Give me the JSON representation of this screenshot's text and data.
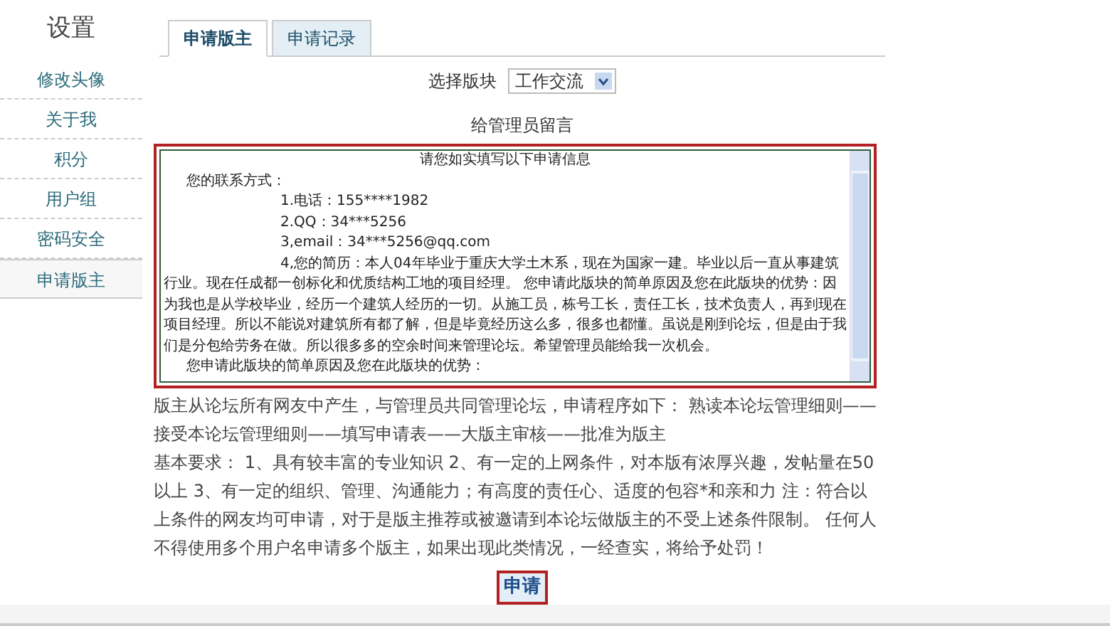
{
  "sidebar": {
    "title": "设置",
    "items": [
      {
        "label": "修改头像",
        "selected": false
      },
      {
        "label": "关于我",
        "selected": false
      },
      {
        "label": "积分",
        "selected": false
      },
      {
        "label": "用户组",
        "selected": false
      },
      {
        "label": "密码安全",
        "selected": false
      },
      {
        "label": "申请版主",
        "selected": true
      }
    ]
  },
  "tabs": [
    {
      "label": "申请版主",
      "selected": true
    },
    {
      "label": "申请记录",
      "selected": false
    }
  ],
  "board_select": {
    "label": "选择版块",
    "value": "工作交流"
  },
  "message": {
    "label": "给管理员留言",
    "highlighted": true,
    "lines": [
      {
        "kind": "title",
        "text": "请您如实填写以下申请信息"
      },
      {
        "kind": "label",
        "text": "您的联系方式："
      },
      {
        "kind": "item",
        "text": "1.电话：155****1982"
      },
      {
        "kind": "item",
        "text": "2.QQ：34***5256"
      },
      {
        "kind": "item",
        "text": "3,email：34***5256@qq.com"
      },
      {
        "kind": "paragraph",
        "text": "4,您的简历：本人04年毕业于重庆大学土木系，现在为国家一建。毕业以后一直从事建筑行业。现在任成都一创标化和优质结构工地的项目经理。 您申请此版块的简单原因及您在此版块的优势：因为我也是从学校毕业，经历一个建筑人经历的一切。从施工员，栋号工长，责任工长，技术负责人，再到现在项目经理。所以不能说对建筑所有都了解，但是毕竟经历这么多，很多也都懂。虽说是刚到论坛，但是由于我们是分包给劳务在做。所以很多多的空余时间来管理论坛。希望管理员能给我一次机会。"
      },
      {
        "kind": "label",
        "text": "您申请此版块的简单原因及您在此版块的优势："
      }
    ]
  },
  "notes": [
    "版主从论坛所有网友中产生，与管理员共同管理论坛，申请程序如下： 熟读本论坛管理细则——接受本论坛管理细则——填写申请表——大版主审核——批准为版主",
    "基本要求： 1、具有较丰富的专业知识 2、有一定的上网条件，对本版有浓厚兴趣，发帖量在50以上 3、有一定的组织、管理、沟通能力；有高度的责任心、适度的包容*和亲和力 注：符合以上条件的网友均可申请，对于是版主推荐或被邀请到本论坛做版主的不受上述条件限制。 任何人不得使用多个用户名申请多个版主，如果出现此类情况，一经查实，将给予处罚！"
  ],
  "submit": {
    "label": "申请",
    "highlighted": true
  }
}
